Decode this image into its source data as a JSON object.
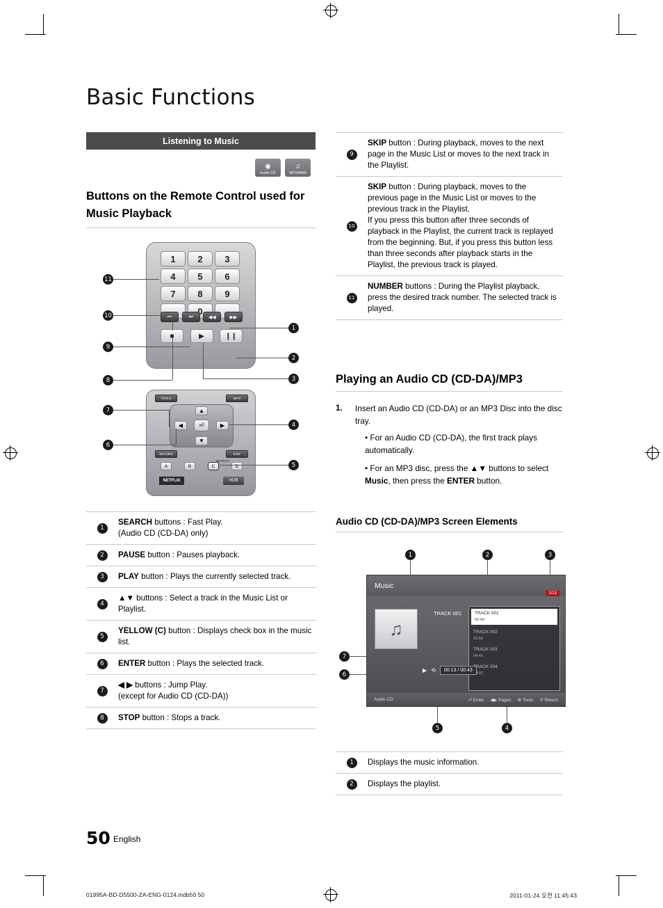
{
  "page": {
    "title": "Basic Functions",
    "section_bar": "Listening to Music",
    "badges": [
      {
        "label": "Audio CD",
        "glyph": "◉"
      },
      {
        "label": "MP3/WMA",
        "glyph": "♫"
      }
    ],
    "subheading": "Buttons on the Remote Control used for Music Playback",
    "page_number": "50",
    "page_lang": "English",
    "footer_left": "01995A-BD-D5500-ZA-ENG-0124.indb50   50",
    "footer_right": "2011-01-24   오전 11:45:43"
  },
  "remote": {
    "keys": [
      "1",
      "2",
      "3",
      "4",
      "5",
      "6",
      "7",
      "8",
      "9",
      "",
      "0",
      ""
    ],
    "transport": [
      "⏮",
      "⏭",
      "◀◀",
      "▶▶"
    ],
    "playback": [
      "■",
      "▶",
      "❙❙"
    ],
    "top_small": [
      "TOOLS",
      "INFO"
    ],
    "dpad": {
      "up": "▲",
      "down": "▼",
      "left": "◀",
      "right": "▶",
      "center": "⏎"
    },
    "return_exit": [
      "RETURN",
      "EXIT"
    ],
    "color_buttons": [
      "A",
      "B",
      "C",
      "D"
    ],
    "search_label": "SEARCH",
    "netflix": "NETFLIX",
    "hub": "HUB"
  },
  "callouts_left": [
    "1",
    "2",
    "3",
    "4",
    "5",
    "6",
    "7",
    "8",
    "9",
    "10",
    "11"
  ],
  "left_table": [
    {
      "num": "1",
      "strong": "SEARCH",
      "text": " buttons : Fast Play.\n(Audio CD (CD-DA) only)"
    },
    {
      "num": "2",
      "strong": "PAUSE",
      "text": " button : Pauses playback."
    },
    {
      "num": "3",
      "strong": "PLAY",
      "text": " button : Plays the currently selected track."
    },
    {
      "num": "4",
      "strong": "▲▼",
      "text": " buttons : Select a track in the Music List or Playlist."
    },
    {
      "num": "5",
      "strong": "YELLOW (C)",
      "text": " button : Displays check box in the music list."
    },
    {
      "num": "6",
      "strong": "ENTER",
      "text": " button : Plays the selected track."
    },
    {
      "num": "7",
      "strong": "◀ ▶",
      "text": " buttons : Jump Play.\n(except for Audio CD (CD-DA))"
    },
    {
      "num": "8",
      "strong": "STOP",
      "text": " button : Stops a track."
    }
  ],
  "right_table": [
    {
      "num": "9",
      "strong": "SKIP",
      "text": " button : During playback, moves to the next page in the Music List or moves to the next track in the Playlist."
    },
    {
      "num": "10",
      "strong": "SKIP",
      "text": " button : During playback, moves to the previous page in the Music List or moves to the previous track in the Playlist.\nIf you press this button after three seconds of playback in the Playlist, the current track is replayed from the beginning. But, if you press this button less than three seconds after playback starts in the Playlist, the previous track is played."
    },
    {
      "num": "11",
      "strong": "NUMBER",
      "text": " buttons : During the Playlist playback, press the desired track number. The selected track is played."
    }
  ],
  "playing": {
    "heading": "Playing an Audio CD (CD-DA)/MP3",
    "step_num": "1.",
    "step_text": "Insert an Audio CD (CD-DA) or an MP3 Disc into the disc tray.",
    "bullets": [
      "For an Audio CD (CD-DA), the first track plays automatically.",
      "For an MP3 disc, press the ▲▼ buttons to select Music, then press the ENTER button."
    ]
  },
  "screen_elements": {
    "heading": "Audio CD (CD-DA)/MP3 Screen Elements",
    "callouts": [
      "1",
      "2",
      "3",
      "7",
      "6",
      "5",
      "4"
    ],
    "mock": {
      "title": "Music",
      "page_badge": "1/13",
      "now_playing": "TRACK 001",
      "playlist": [
        {
          "name": "TRACK 001",
          "time": "00:43"
        },
        {
          "name": "TRACK 002",
          "time": "03:56"
        },
        {
          "name": "TRACK 003",
          "time": "04:41"
        },
        {
          "name": "TRACK 004",
          "time": "04:02"
        }
      ],
      "time_display": "00:13 / 00:43",
      "source_label": "Audio CD",
      "footer_keys": [
        "Enter",
        "Pages",
        "Tools",
        "Return"
      ],
      "play_icon": "▶",
      "repeat_icon": "⟲"
    },
    "legend": [
      {
        "num": "1",
        "text": "Displays the music information."
      },
      {
        "num": "2",
        "text": "Displays the playlist."
      }
    ]
  }
}
